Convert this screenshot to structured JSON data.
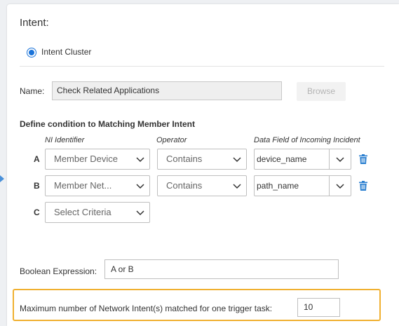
{
  "intent": {
    "title": "Intent:",
    "radio_label": "Intent Cluster"
  },
  "name": {
    "label": "Name:",
    "value": "Check Related Applications",
    "browse_label": "Browse"
  },
  "conditions": {
    "heading": "Define condition to Matching Member Intent",
    "columns": {
      "ni_identifier": "NI Identifier",
      "operator": "Operator",
      "data_field": "Data Field of Incoming Incident"
    },
    "rows": [
      {
        "label": "A",
        "ni": "Member Device",
        "operator": "Contains",
        "field": "device_name"
      },
      {
        "label": "B",
        "ni": "Member Net...",
        "operator": "Contains",
        "field": "path_name"
      },
      {
        "label": "C",
        "ni": "Select Criteria"
      }
    ]
  },
  "boolean": {
    "label": "Boolean Expression:",
    "value": "A or B"
  },
  "max_intents": {
    "label": "Maximum number of Network Intent(s) matched for one trigger task:",
    "value": "10"
  },
  "colors": {
    "accent": "#1a73d9",
    "highlight": "#f0b030",
    "delete_icon": "#2a7fd0"
  }
}
